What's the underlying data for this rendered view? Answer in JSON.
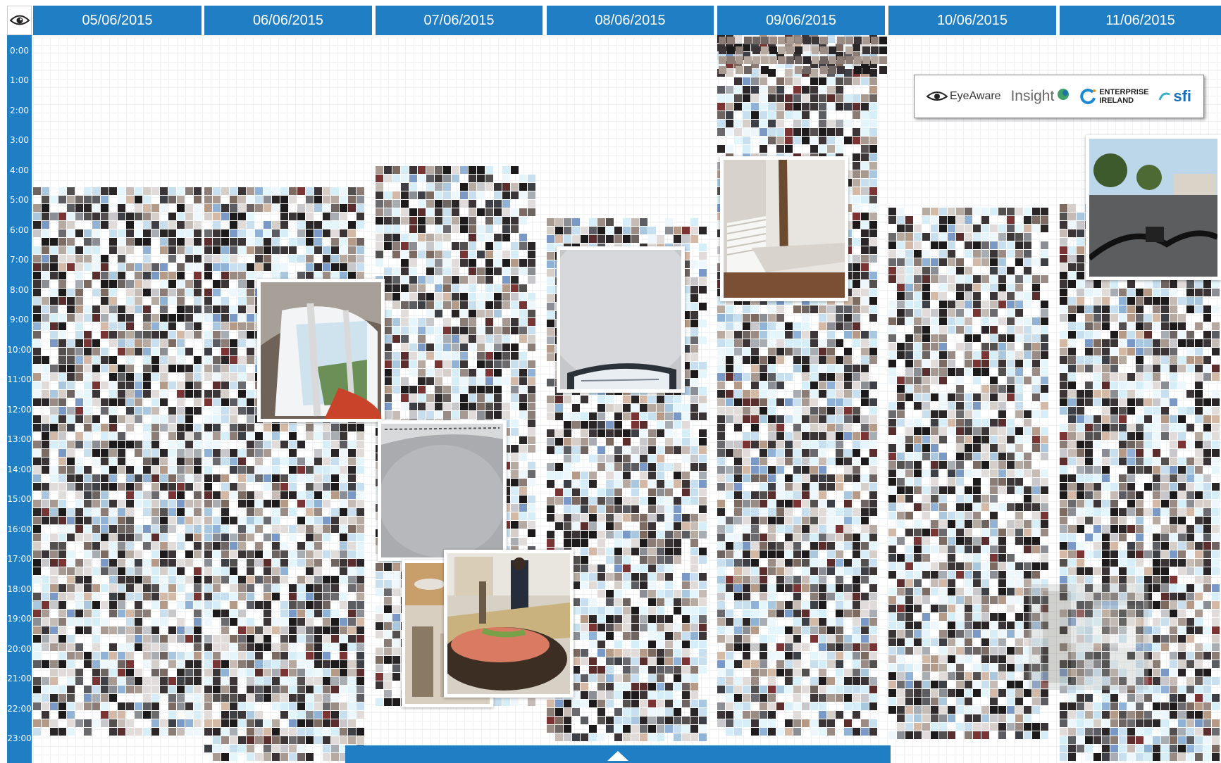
{
  "colors": {
    "accent": "#1f7ec4",
    "grid": "#eef2f5"
  },
  "header": {
    "corner_icon": "eye-icon",
    "days": [
      "05/06/2015",
      "06/06/2015",
      "07/06/2015",
      "08/06/2015",
      "09/06/2015",
      "10/06/2015",
      "11/06/2015"
    ]
  },
  "timeline": {
    "hours": [
      "0:00",
      "1:00",
      "2:00",
      "3:00",
      "4:00",
      "5:00",
      "6:00",
      "7:00",
      "8:00",
      "9:00",
      "10:00",
      "11:00",
      "12:00",
      "13:00",
      "14:00",
      "15:00",
      "16:00",
      "17:00",
      "18:00",
      "19:00",
      "20:00",
      "21:00",
      "22:00",
      "23:00"
    ]
  },
  "logos": {
    "eyeaware": "EyeAware",
    "insight": "Insight",
    "enterprise_ireland_line1": "ENTERPRISE",
    "enterprise_ireland_line2": "IRELAND",
    "sfi": "sfi"
  },
  "photos": [
    {
      "name": "photo-window-0606",
      "icon": "photo-window"
    },
    {
      "name": "photo-wall-0608",
      "icon": "photo-laptop"
    },
    {
      "name": "photo-room-0609",
      "icon": "photo-room"
    },
    {
      "name": "photo-street-0611",
      "icon": "photo-street"
    },
    {
      "name": "photo-ceiling-0607",
      "icon": "photo-ceiling"
    },
    {
      "name": "photo-table-0607",
      "icon": "photo-table"
    },
    {
      "name": "photo-dinner-0607",
      "icon": "photo-dinner"
    }
  ],
  "bottom_bar": {
    "icon": "collapse-up-icon"
  }
}
